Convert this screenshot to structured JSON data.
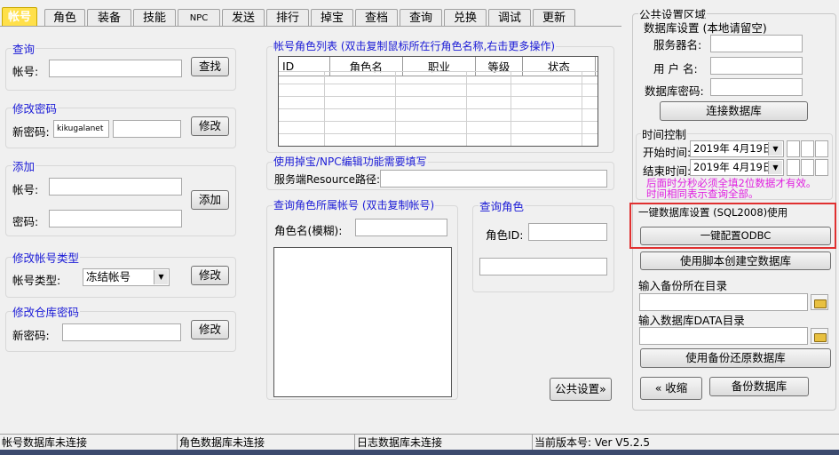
{
  "tabs": [
    "帐号",
    "角色",
    "装备",
    "技能",
    "NPC",
    "发送",
    "排行",
    "掉宝",
    "查档",
    "查询",
    "兑换",
    "调试",
    "更新"
  ],
  "active_tab": "帐号",
  "query": {
    "title": "查询",
    "account_label": "帐号:",
    "button": "查找"
  },
  "change_password": {
    "title": "修改密码",
    "label": "新密码:",
    "value": "kikugalanet",
    "button": "修改"
  },
  "add": {
    "title": "添加",
    "account_label": "帐号:",
    "password_label": "密码:",
    "button": "添加"
  },
  "change_type": {
    "title": "修改帐号类型",
    "label": "帐号类型:",
    "selected": "冻结帐号",
    "button": "修改"
  },
  "change_warehouse": {
    "title": "修改仓库密码",
    "label": "新密码:",
    "button": "修改"
  },
  "role_list": {
    "title": "帐号角色列表 (双击复制鼠标所在行角色名称,右击更多操作)",
    "columns": [
      "ID",
      "角色名",
      "职业",
      "等级",
      "状态"
    ]
  },
  "drop_npc": {
    "title": "使用掉宝/NPC编辑功能需要填写",
    "label": "服务端Resource路径:"
  },
  "query_role_account": {
    "title": "查询角色所属帐号 (双击复制帐号)",
    "label": "角色名(模糊):"
  },
  "query_role": {
    "title": "查询角色",
    "label": "角色ID:"
  },
  "public_settings_button": "公共设置»",
  "right": {
    "area_title": "公共设置区域",
    "db_title": "数据库设置 (本地请留空)",
    "server_label": "服务器名:",
    "user_label": "用 户 名:",
    "dbpass_label": "数据库密码:",
    "connect_button": "连接数据库",
    "time_title": "时间控制",
    "start_label": "开始时间:",
    "start_value": "2019年 4月19日",
    "end_label": "结束时间:",
    "end_value": "2019年 4月19日",
    "note1": "后面时分秒必须全填2位数据才有效。",
    "note2": "时间相同表示查询全部。",
    "odbc_title": "一键数据库设置 (SQL2008)使用",
    "odbc_button": "一键配置ODBC",
    "script_button": "使用脚本创建空数据库",
    "backup_dir_label": "输入备份所在目录",
    "data_dir_label": "输入数据库DATA目录",
    "restore_button": "使用备份还原数据库",
    "collapse_button": "« 收缩",
    "backup_button": "备份数据库"
  },
  "colors": {
    "note": "#e020e0",
    "highlight": "#e03030",
    "group_title": "#1a1ad6"
  },
  "status": [
    "帐号数据库未连接",
    "角色数据库未连接",
    "日志数据库未连接",
    "当前版本号: Ver V5.2.5"
  ]
}
